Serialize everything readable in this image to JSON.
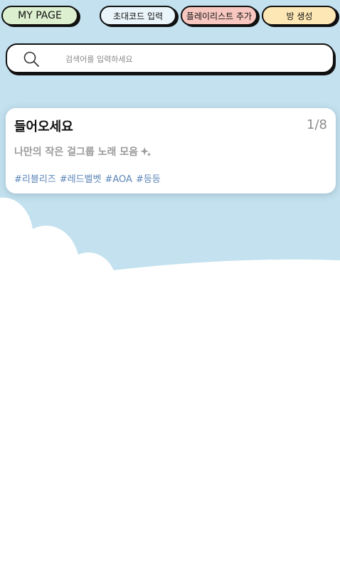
{
  "header": {
    "mypage_label": "MY PAGE",
    "invite_label": "초대코드 입력",
    "playlist_label": "플레이리스트 추가",
    "create_room_label": "방 생성"
  },
  "search": {
    "placeholder": "검색어를 입력하세요",
    "icon": "search-icon"
  },
  "room_card": {
    "title": "들어오세요",
    "occupancy": "1/8",
    "description": "나만의 작은 걸그룹 노래 모음",
    "description_icon": "sparkle-icon",
    "tags": [
      "#리블리즈",
      "#레드벨벳",
      "#AOA",
      "#등등"
    ]
  },
  "colors": {
    "background_sky": "#c3e1ef",
    "mypage_button": "#dcefcf",
    "invite_button": "#eaf5fb",
    "playlist_button": "#f8c8c0",
    "create_button": "#fde7b5",
    "tag_text": "#5b85b8"
  }
}
